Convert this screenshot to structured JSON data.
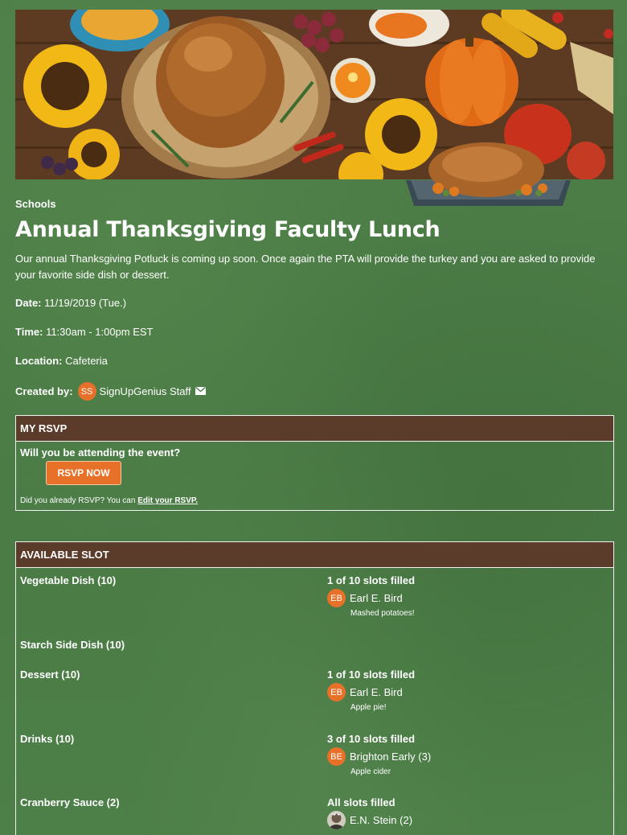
{
  "event": {
    "category": "Schools",
    "title": "Annual Thanksgiving Faculty Lunch",
    "description": "Our annual Thanksgiving Potluck is coming up soon. Once again the PTA will provide the turkey and you are asked to provide your favorite side dish or dessert.",
    "date_label": "Date:",
    "date_value": "11/19/2019 (Tue.)",
    "time_label": "Time:",
    "time_value": "11:30am - 1:00pm EST",
    "location_label": "Location:",
    "location_value": "Cafeteria",
    "created_label": "Created by:",
    "creator_initials": "SS",
    "creator_name": "SignUpGenius Staff",
    "creator_contact_icon": "envelope-icon"
  },
  "rsvp": {
    "header": "MY RSVP",
    "question": "Will you be attending the event?",
    "button": "RSVP NOW",
    "note": "Did you already RSVP? You can ",
    "edit_link": "Edit your RSVP."
  },
  "slots": {
    "header": "AVAILABLE SLOT",
    "rows": [
      {
        "name": "Vegetable Dish (10)",
        "status": "1 of 10 slots filled",
        "initials": "EB",
        "person": "Earl E. Bird",
        "note": "Mashed potatoes!"
      },
      {
        "name": "Starch Side Dish (10)",
        "status": "",
        "initials": "",
        "person": "",
        "note": ""
      },
      {
        "name": "Dessert (10)",
        "status": "1 of 10 slots filled",
        "initials": "EB",
        "person": "Earl E. Bird",
        "note": "Apple pie!"
      },
      {
        "name": "Drinks (10)",
        "status": "3 of 10 slots filled",
        "initials": "BE",
        "person": "Brighton Early (3)",
        "note": "Apple cider"
      },
      {
        "name": "Cranberry Sauce (2)",
        "status": "All slots filled",
        "initials": "",
        "person": "E.N. Stein (2)",
        "note": ""
      }
    ]
  },
  "colors": {
    "background": "#4e7d49",
    "header_brown": "#5b3b2a",
    "accent_orange": "#e8712a"
  }
}
